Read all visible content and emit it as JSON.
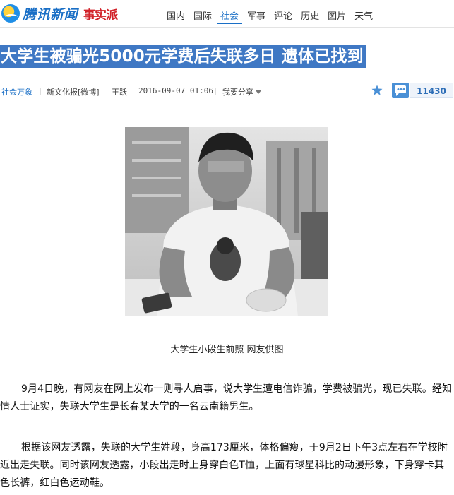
{
  "brand": {
    "name": "腾讯新闻",
    "sub": "事实派"
  },
  "nav": [
    {
      "label": "国内",
      "active": false
    },
    {
      "label": "国际",
      "active": false
    },
    {
      "label": "社会",
      "active": true
    },
    {
      "label": "军事",
      "active": false
    },
    {
      "label": "评论",
      "active": false
    },
    {
      "label": "历史",
      "active": false
    },
    {
      "label": "图片",
      "active": false
    },
    {
      "label": "天气",
      "active": false
    }
  ],
  "article": {
    "title": "大学生被骗光5000元学费后失联多日 遗体已找到",
    "source": "社会万象",
    "paper": "新文化报[微博]",
    "author": "王跃",
    "time": "2016-09-07 01:06",
    "share": "我要分享",
    "comments": "11430",
    "caption": "大学生小段生前照 网友供图",
    "paragraphs": [
      "9月4日晚，有网友在网上发布一则寻人启事，说大学生遭电信诈骗，学费被骗光，现已失联。经知情人士证实，失联大学生是长春某大学的一名云南籍男生。",
      "根据该网友透露，失联的大学生姓段，身高173厘米，体格偏瘦，于9月2日下午3点左右在学校附近出走失联。同时该网友透露，小段出走时上身穿白色T恤，上面有球星科比的动漫形象，下身穿卡其色长裤，红白色运动鞋。"
    ]
  },
  "colors": {
    "accent": "#1a6fc6",
    "title_bg": "#3f78c4",
    "brand_red": "#d2232a"
  }
}
